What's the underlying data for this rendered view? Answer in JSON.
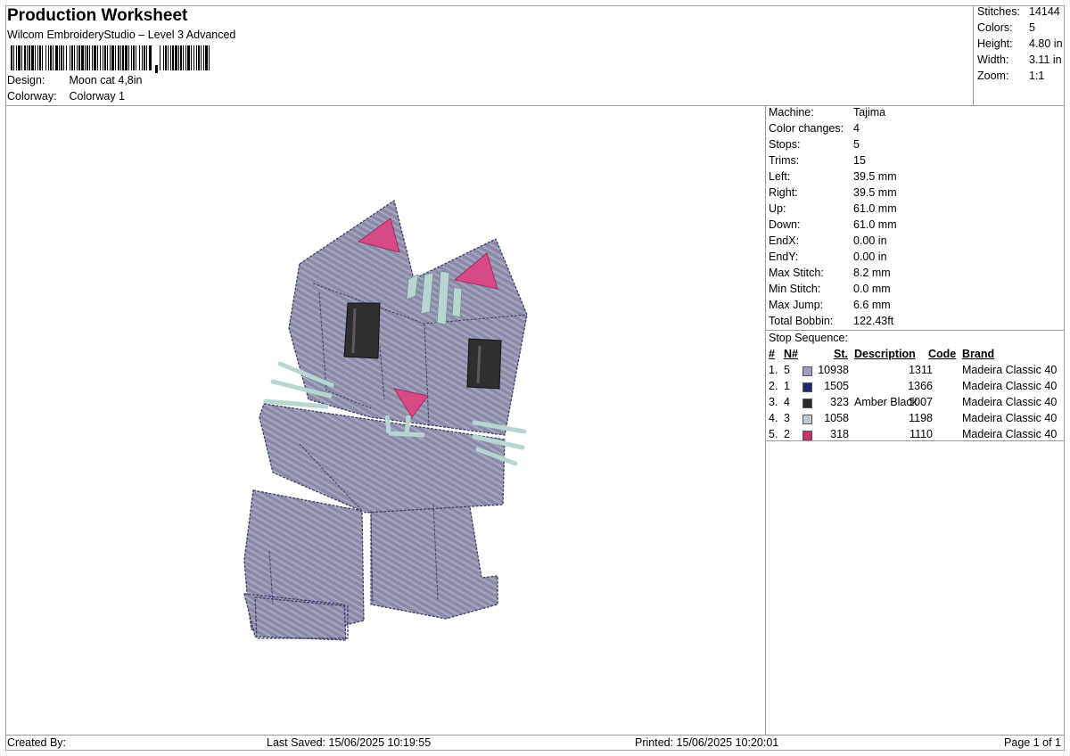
{
  "header": {
    "title": "Production Worksheet",
    "subtitle": "Wilcom EmbroideryStudio – Level 3 Advanced",
    "design_label": "Design:",
    "design_value": "Moon cat 4,8in",
    "colorway_label": "Colorway:",
    "colorway_value": "Colorway 1"
  },
  "stats": [
    {
      "label": "Stitches:",
      "value": "14144"
    },
    {
      "label": "Colors:",
      "value": "5"
    },
    {
      "label": "Height:",
      "value": "4.80 in"
    },
    {
      "label": "Width:",
      "value": "3.11 in"
    },
    {
      "label": "Zoom:",
      "value": "1:1"
    }
  ],
  "machine_info": [
    {
      "label": "Machine:",
      "value": "Tajima"
    },
    {
      "label": "Color changes:",
      "value": "4"
    },
    {
      "label": "Stops:",
      "value": "5"
    },
    {
      "label": "Trims:",
      "value": "15"
    },
    {
      "label": "Left:",
      "value": "39.5 mm"
    },
    {
      "label": "Right:",
      "value": "39.5 mm"
    },
    {
      "label": "Up:",
      "value": "61.0 mm"
    },
    {
      "label": "Down:",
      "value": "61.0 mm"
    },
    {
      "label": "EndX:",
      "value": "0.00 in"
    },
    {
      "label": "EndY:",
      "value": "0.00 in"
    },
    {
      "label": "Max Stitch:",
      "value": "8.2 mm"
    },
    {
      "label": "Min Stitch:",
      "value": "0.0 mm"
    },
    {
      "label": "Max Jump:",
      "value": "6.6 mm"
    },
    {
      "label": "Total Bobbin:",
      "value": "122.43ft"
    }
  ],
  "stop_sequence": {
    "title": "Stop Sequence:",
    "headers": {
      "num": "#",
      "n": "N#",
      "st": "St.",
      "desc": "Description",
      "code": "Code",
      "brand": "Brand"
    },
    "rows": [
      {
        "num": "1.",
        "n": "5",
        "color": "#9c9cc4",
        "st": "10938",
        "desc": "",
        "code": "1311",
        "brand": "Madeira Classic 40"
      },
      {
        "num": "2.",
        "n": "1",
        "color": "#1f2a6e",
        "st": "1505",
        "desc": "",
        "code": "1366",
        "brand": "Madeira Classic 40"
      },
      {
        "num": "3.",
        "n": "4",
        "color": "#2b2b2b",
        "st": "323",
        "desc": "Amber Black",
        "code": "1007",
        "brand": "Madeira Classic 40"
      },
      {
        "num": "4.",
        "n": "3",
        "color": "#bcc8d2",
        "st": "1058",
        "desc": "",
        "code": "1198",
        "brand": "Madeira Classic 40"
      },
      {
        "num": "5.",
        "n": "2",
        "color": "#c8336e",
        "st": "318",
        "desc": "",
        "code": "1110",
        "brand": "Madeira Classic 40"
      }
    ]
  },
  "footer": {
    "created_by": "Created By:",
    "last_saved": "Last Saved: 15/06/2025 10:19:55",
    "printed": "Printed: 15/06/2025 10:20:01",
    "page": "Page 1 of 1"
  },
  "design_colors": {
    "body": "#8f90ad",
    "outline": "#3c3f63",
    "ear_inner": "#d64a86",
    "eyes": "#2f2f2f",
    "whisker": "#b7d6d2"
  }
}
